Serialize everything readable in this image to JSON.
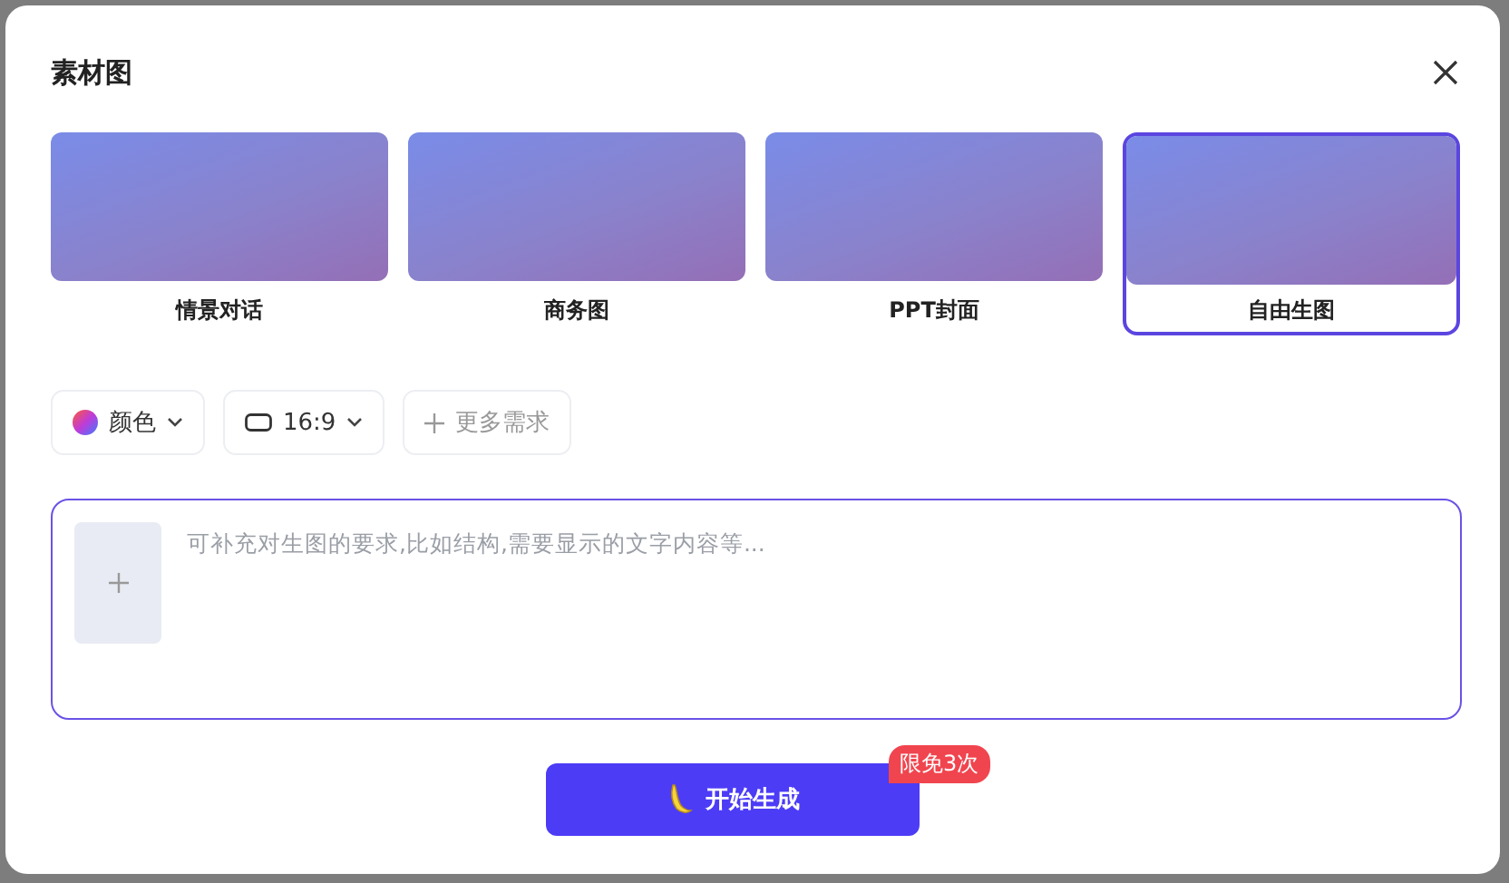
{
  "dialog": {
    "title": "素材图"
  },
  "categories": [
    {
      "label": "情景对话",
      "selected": false
    },
    {
      "label": "商务图",
      "selected": false
    },
    {
      "label": "PPT封面",
      "selected": false
    },
    {
      "label": "自由生图",
      "selected": true
    }
  ],
  "options": [
    {
      "kind": "color",
      "label": "颜色"
    },
    {
      "kind": "ratio",
      "label": "16:9"
    },
    {
      "kind": "more",
      "label": "更多需求"
    }
  ],
  "prompt": {
    "placeholder": "可补充对生图的要求,比如结构,需要显示的文字内容等..."
  },
  "generate": {
    "label": "开始生成",
    "badge": "限免3次"
  }
}
